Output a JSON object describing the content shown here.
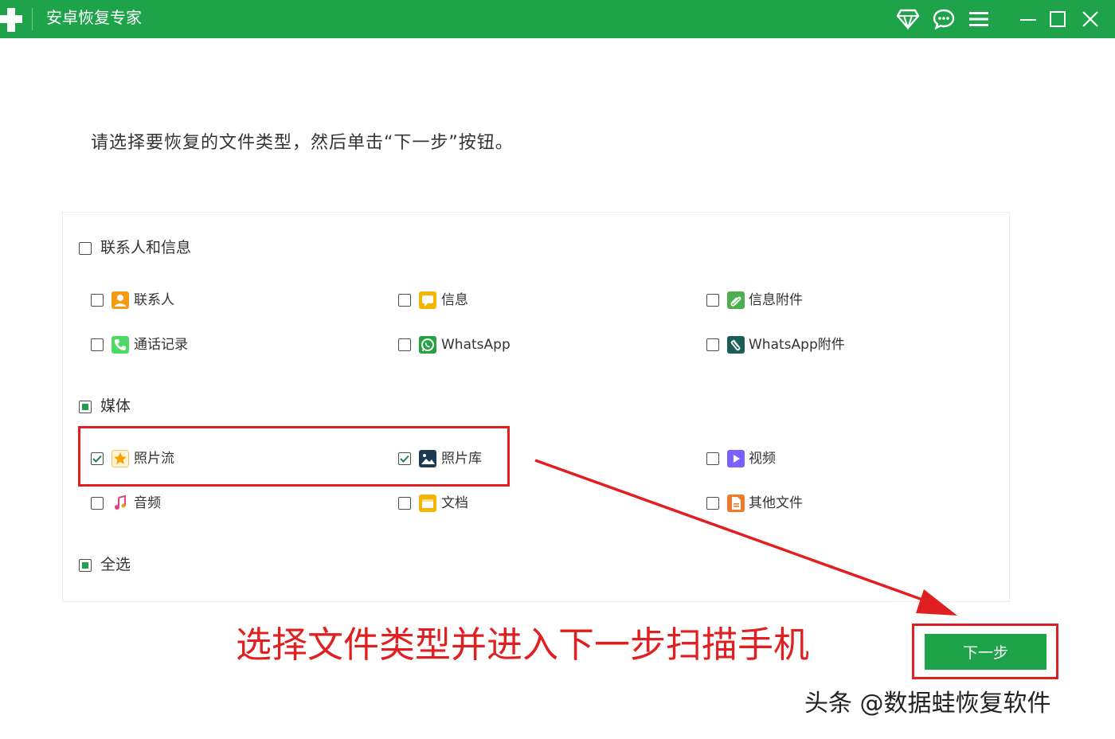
{
  "window": {
    "title": "安卓恢复专家"
  },
  "prompt": "请选择要恢复的文件类型，然后单击“下一步”按钮。",
  "groups": {
    "contacts": {
      "label": "联系人和信息",
      "state": "unchecked"
    },
    "media": {
      "label": "媒体",
      "state": "partial"
    },
    "select_all": {
      "label": "全选",
      "state": "partial"
    }
  },
  "items": {
    "contacts": {
      "label": "联系人",
      "checked": false
    },
    "messages": {
      "label": "信息",
      "checked": false
    },
    "message_attachments": {
      "label": "信息附件",
      "checked": false
    },
    "call_logs": {
      "label": "通话记录",
      "checked": false
    },
    "whatsapp": {
      "label": "WhatsApp",
      "checked": false
    },
    "whatsapp_attachments": {
      "label": "WhatsApp附件",
      "checked": false
    },
    "photo_stream": {
      "label": "照片流",
      "checked": true
    },
    "photo_library": {
      "label": "照片库",
      "checked": true
    },
    "videos": {
      "label": "视频",
      "checked": false
    },
    "audio": {
      "label": "音频",
      "checked": false
    },
    "documents": {
      "label": "文档",
      "checked": false
    },
    "other_files": {
      "label": "其他文件",
      "checked": false
    }
  },
  "next_button": {
    "label": "下一步"
  },
  "annotation": "选择文件类型并进入下一步扫描手机",
  "watermark": "头条 @数据蛙恢复软件",
  "colors": {
    "brand_green": "#1ea24a",
    "annotation_red": "#e02020"
  }
}
